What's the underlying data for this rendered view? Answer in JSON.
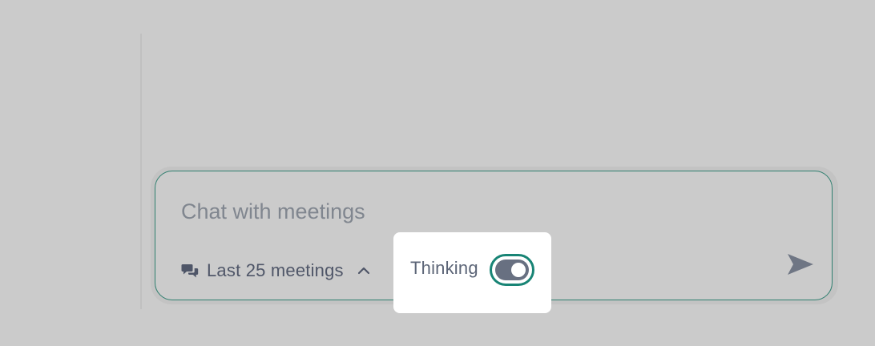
{
  "chat": {
    "placeholder": "Chat with meetings",
    "value": ""
  },
  "scope": {
    "label": "Last 25 meetings",
    "icon": "chat-bubbles-icon",
    "chevron_icon": "chevron-up-icon"
  },
  "thinking": {
    "label": "Thinking",
    "enabled": true
  },
  "send": {
    "icon": "send-icon"
  },
  "colors": {
    "accent": "#188475",
    "border": "#2f7f6f",
    "text": "#4f5668",
    "placeholder": "#80868f",
    "toggle_track": "#687081",
    "backdrop": "#cbcbcb"
  }
}
